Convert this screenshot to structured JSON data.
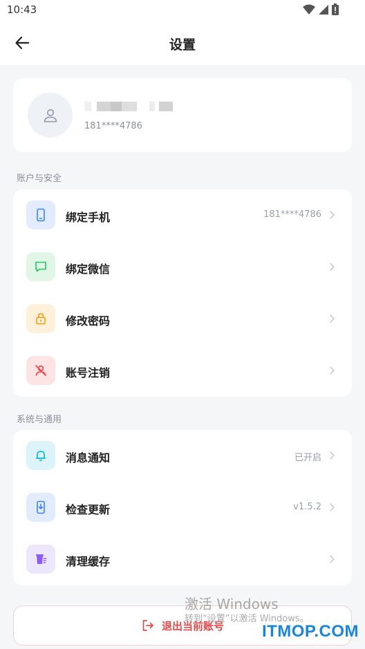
{
  "status_bar": {
    "time": "10:43"
  },
  "header": {
    "title": "设置"
  },
  "profile": {
    "phone": "181****4786"
  },
  "account_section": {
    "title": "账户与安全",
    "items": [
      {
        "label": "绑定手机",
        "value": "181****4786",
        "icon": "phone-icon",
        "color": "#3b82f6"
      },
      {
        "label": "绑定微信",
        "value": "",
        "icon": "chat-icon",
        "color": "#22c55e"
      },
      {
        "label": "修改密码",
        "value": "",
        "icon": "lock-icon",
        "color": "#f59e0b"
      },
      {
        "label": "账号注销",
        "value": "",
        "icon": "user-off-icon",
        "color": "#ef4444"
      }
    ]
  },
  "system_section": {
    "title": "系统与通用",
    "items": [
      {
        "label": "消息通知",
        "value": "已开启",
        "icon": "bell-icon",
        "color": "#06b6d4"
      },
      {
        "label": "检查更新",
        "value": "v1.5.2",
        "icon": "download-icon",
        "color": "#3b82f6"
      },
      {
        "label": "清理缓存",
        "value": "",
        "icon": "trash-icon",
        "color": "#8b5cf6"
      }
    ]
  },
  "logout": {
    "label": "退出当前账号"
  },
  "watermark": {
    "title": "激活 Windows",
    "subtitle": "转到“设置”以激活 Windows。",
    "site": "ITMOP.COM"
  }
}
